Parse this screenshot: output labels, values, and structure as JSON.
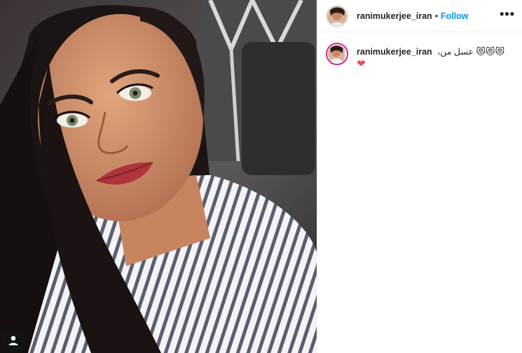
{
  "post": {
    "username": "ranimukerjee_iran",
    "separator": "•",
    "follow_label": "Follow",
    "more_label": "•••",
    "caption": {
      "username": "ranimukerjee_iran",
      "text": "عسل من،",
      "emojis": "😻😻😻",
      "heart": "❤"
    }
  },
  "icons": {
    "tag": "user-tag-icon",
    "more": "more-options-icon",
    "heart": "heart-emoji-icon"
  },
  "colors": {
    "follow": "#0095f6",
    "story_ring": "#d6249f",
    "heart": "#ed4956"
  }
}
